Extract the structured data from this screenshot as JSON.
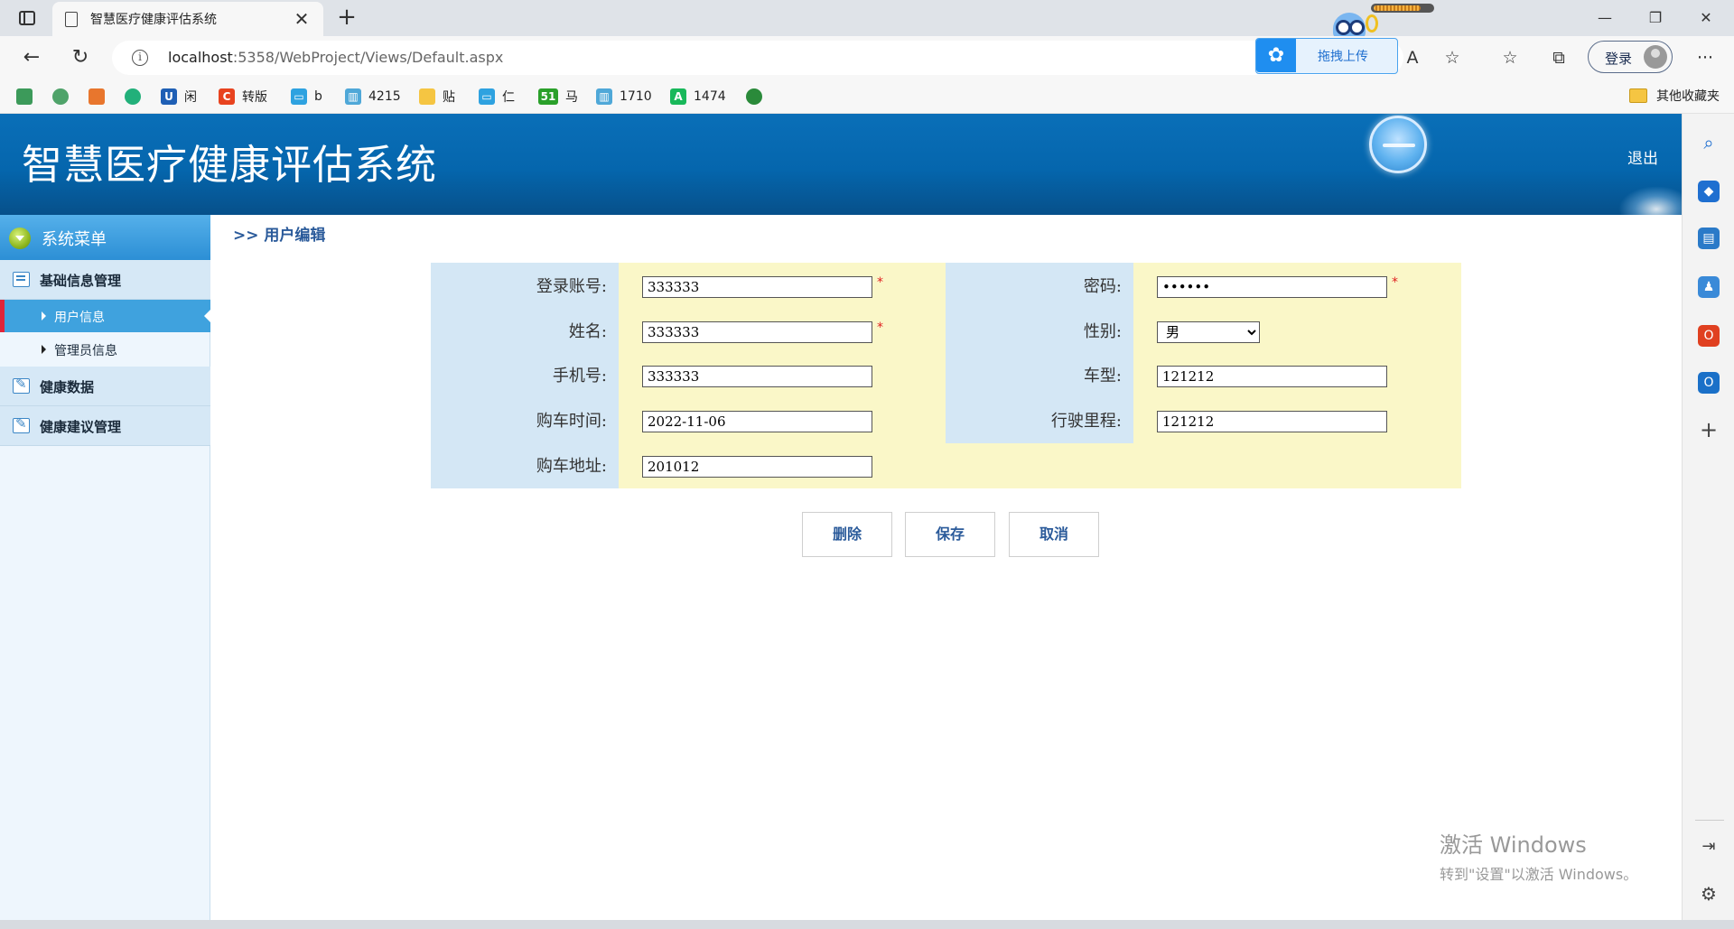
{
  "browser": {
    "tab_title": "智慧医疗健康评估系统",
    "tab_close": "✕",
    "new_tab": "+",
    "url_host": "localhost",
    "url_rest": ":5358/WebProject/Views/Default.aspx",
    "upload_label": "拖拽上传",
    "login_label": "登录",
    "bookmarks": [
      {
        "label": "",
        "icon": "grid-app-icon",
        "color": "#3c9a5a"
      },
      {
        "label": "",
        "icon": "gear-green-icon",
        "color": "#4fa36a"
      },
      {
        "label": "",
        "icon": "orange-square-icon",
        "color": "#e8762d"
      },
      {
        "label": "",
        "icon": "green-circle-icon",
        "color": "#22b07a"
      },
      {
        "label": "闲",
        "icon": "U",
        "color": "#1f5fb5"
      },
      {
        "label": "转版",
        "icon": "C",
        "color": "#e8431f"
      },
      {
        "label": "b",
        "icon": "tv",
        "color": "#2ea2e0"
      },
      {
        "label": "4215",
        "icon": "book",
        "color": "#4fa8d8"
      },
      {
        "label": "贴",
        "icon": "note",
        "color": "#f5c542"
      },
      {
        "label": "仁",
        "icon": "tv",
        "color": "#2ea2e0"
      },
      {
        "label": "马",
        "icon": "51",
        "color": "#2aa02a"
      },
      {
        "label": "1710",
        "icon": "book",
        "color": "#4fa8d8"
      },
      {
        "label": "1474",
        "icon": "A",
        "color": "#18b85a"
      },
      {
        "label": "",
        "icon": "shield-green-icon",
        "color": "#2a8a3a"
      }
    ],
    "other_bookmarks": "其他收藏夹"
  },
  "app": {
    "title": "智慧医疗健康评估系统",
    "logout": "退出",
    "menu_title": "系统菜单",
    "menu": {
      "group1": "基础信息管理",
      "item_user": "用户信息",
      "item_admin": "管理员信息",
      "group2": "健康数据",
      "group3": "健康建议管理"
    },
    "breadcrumb": ">> 用户编辑"
  },
  "form": {
    "account_label": "登录账号:",
    "account_value": "333333",
    "password_label": "密码:",
    "password_value": "••••••",
    "name_label": "姓名:",
    "name_value": "333333",
    "gender_label": "性别:",
    "gender_value": "男",
    "phone_label": "手机号:",
    "phone_value": "333333",
    "car_model_label": "车型:",
    "car_model_value": "121212",
    "purchase_date_label": "购车时间:",
    "purchase_date_value": "2022-11-06",
    "mileage_label": "行驶里程:",
    "mileage_value": "121212",
    "address_label": "购车地址:",
    "address_value": "201012",
    "required_mark": "*"
  },
  "buttons": {
    "delete": "删除",
    "save": "保存",
    "cancel": "取消"
  },
  "watermark": {
    "line1": "激活 Windows",
    "line2": "转到\"设置\"以激活 Windows。"
  }
}
